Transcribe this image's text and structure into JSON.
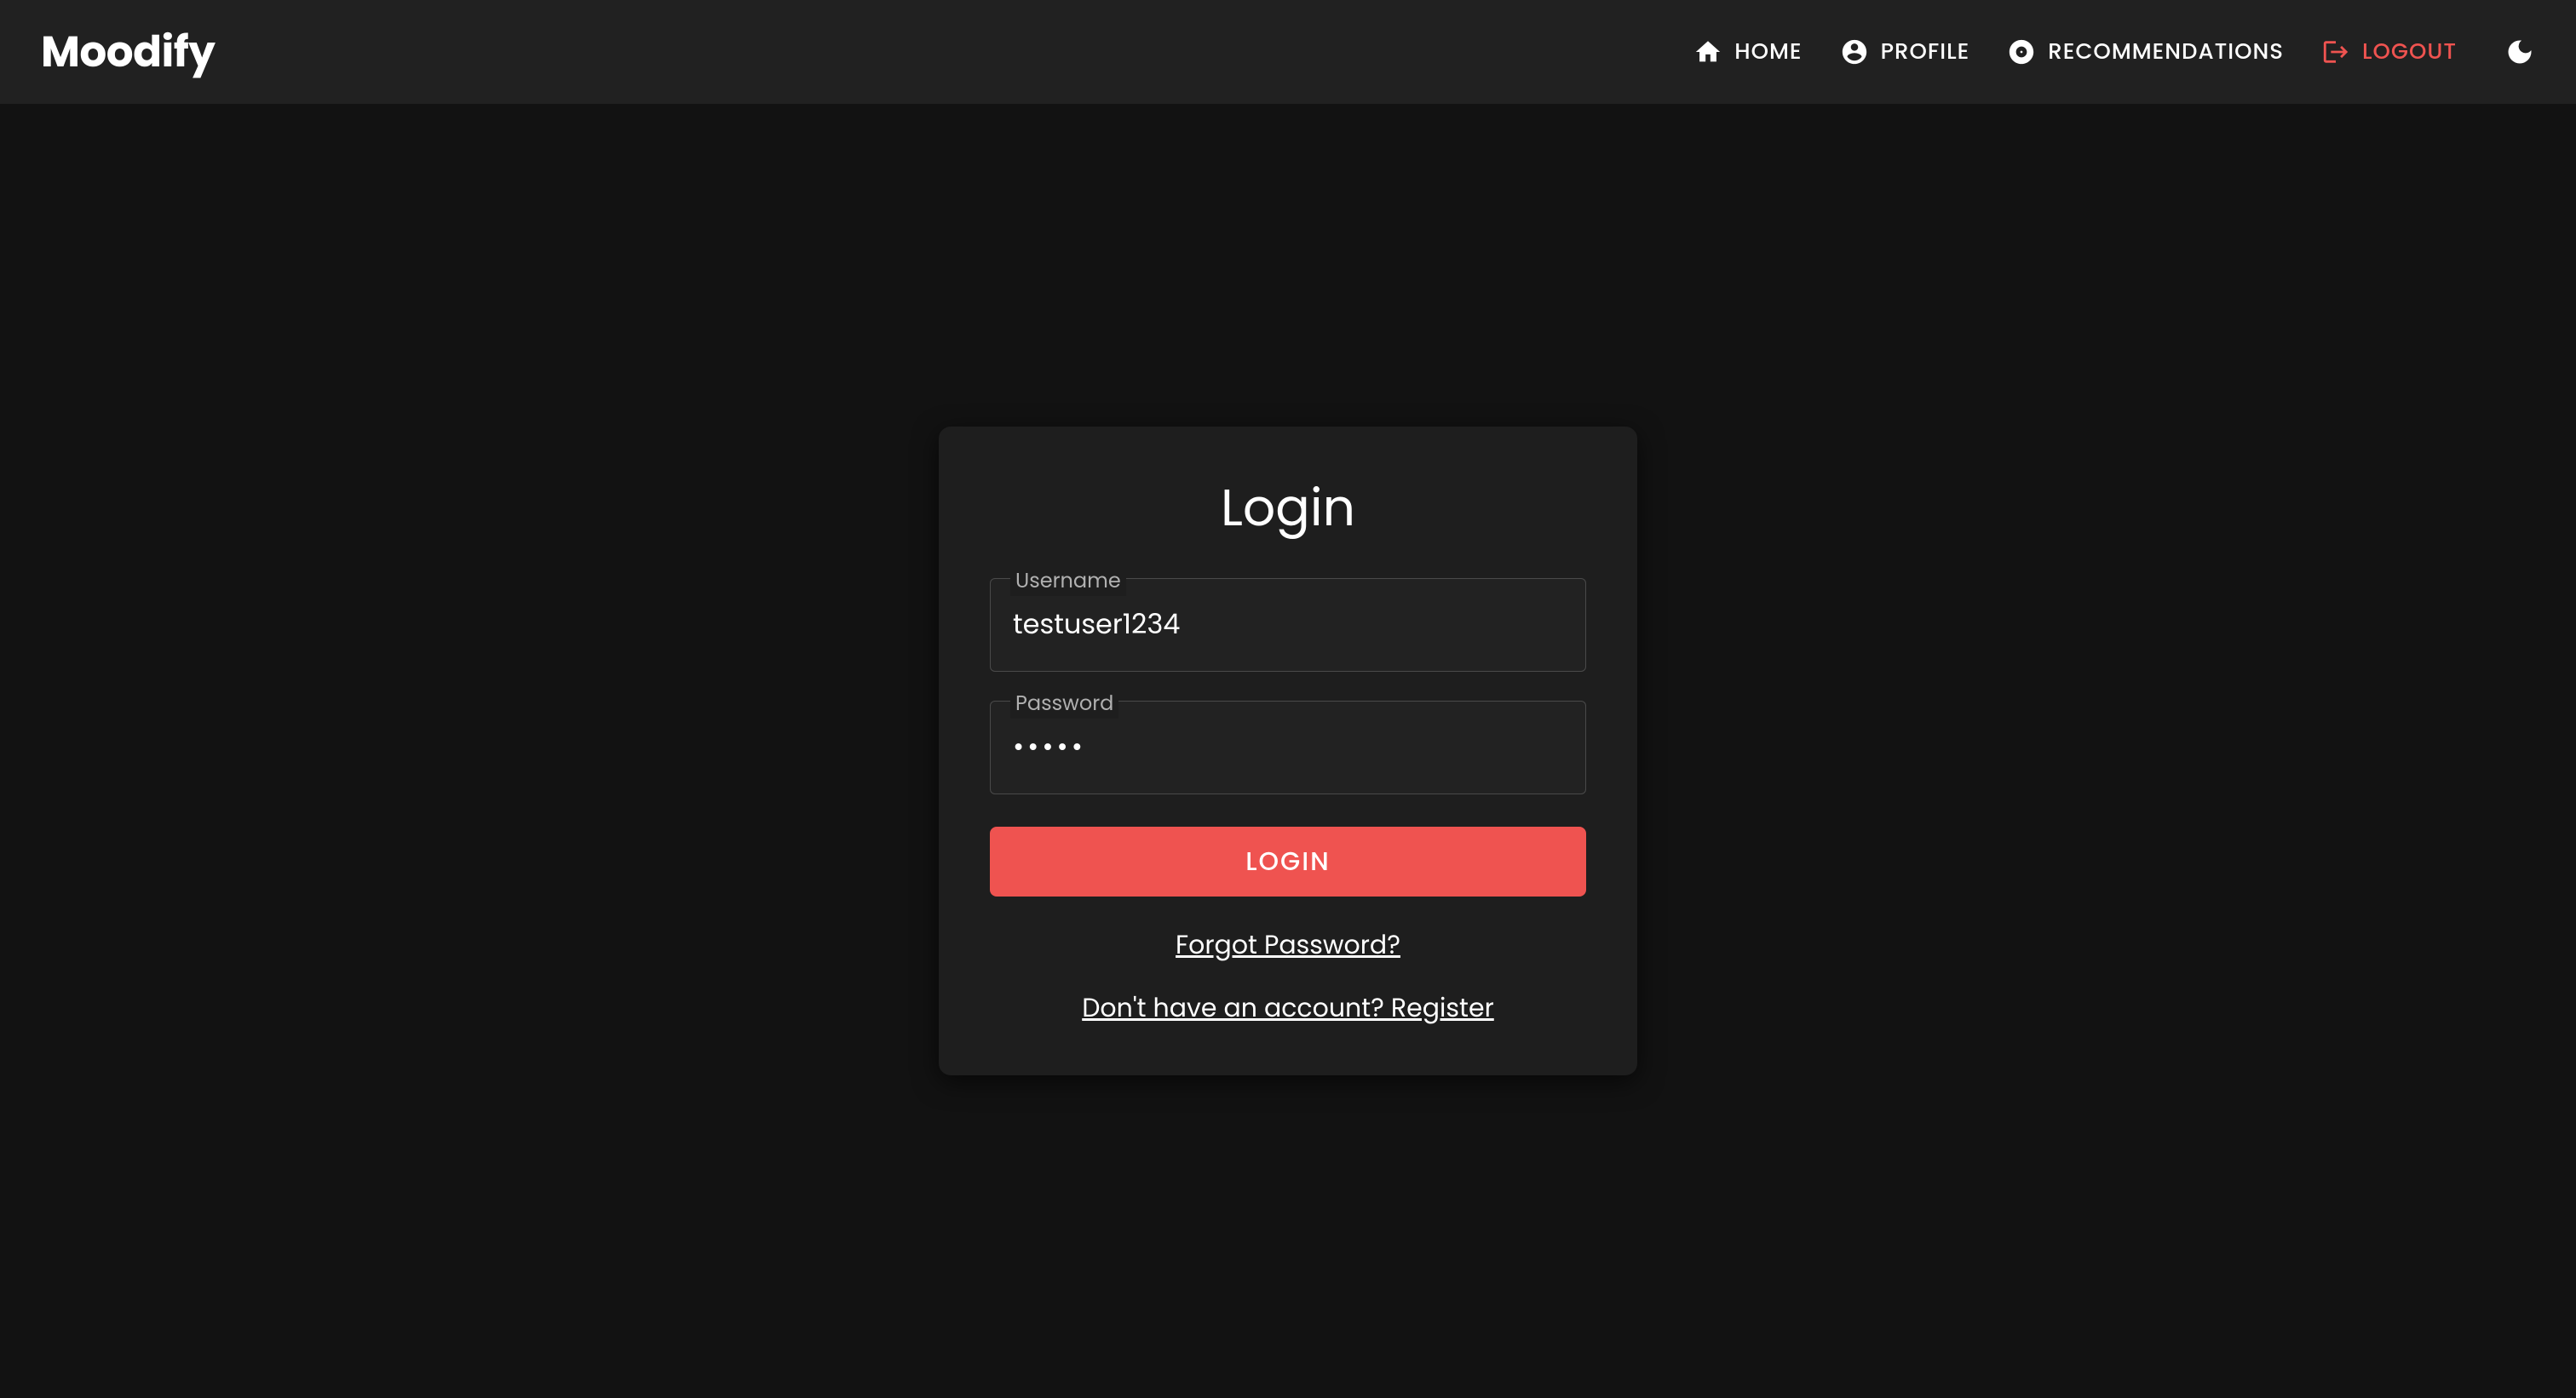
{
  "brand": "Moodify",
  "nav": {
    "home": "HOME",
    "profile": "PROFILE",
    "recommendations": "RECOMMENDATIONS",
    "logout": "LOGOUT"
  },
  "login": {
    "title": "Login",
    "username_label": "Username",
    "username_value": "testuser1234",
    "password_label": "Password",
    "password_value": "•••••",
    "submit_label": "LOGIN",
    "forgot_link": "Forgot Password?",
    "register_link": "Don't have an account? Register"
  },
  "colors": {
    "accent": "#ef5350",
    "background": "#121212",
    "surface": "#1e1e1e",
    "navbar": "#212121"
  }
}
